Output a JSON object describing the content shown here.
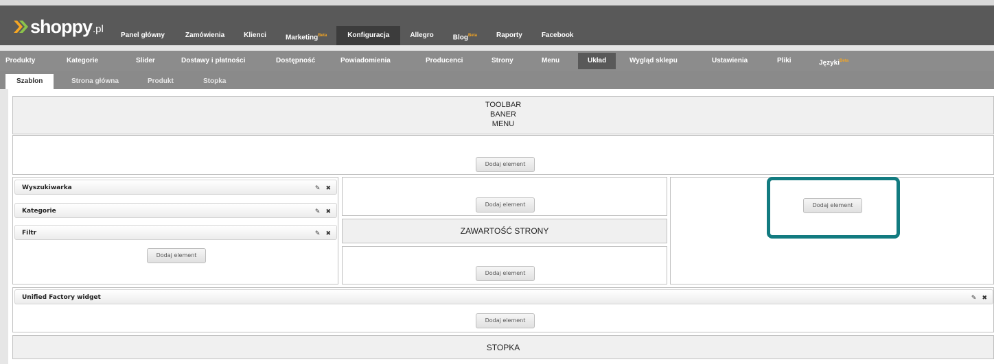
{
  "logo": {
    "brand": "shoppy",
    "tld": ".pl"
  },
  "main_nav": [
    {
      "label": "Panel główny",
      "beta": ""
    },
    {
      "label": "Zamówienia",
      "beta": ""
    },
    {
      "label": "Klienci",
      "beta": ""
    },
    {
      "label": "Marketing",
      "beta": "Beta"
    },
    {
      "label": "Konfiguracja",
      "beta": "",
      "active": true
    },
    {
      "label": "Allegro",
      "beta": ""
    },
    {
      "label": "Blog",
      "beta": "Beta"
    },
    {
      "label": "Raporty",
      "beta": ""
    },
    {
      "label": "Facebook",
      "beta": ""
    }
  ],
  "sub_nav": [
    {
      "label": "Produkty",
      "beta": ""
    },
    {
      "label": "Kategorie",
      "beta": ""
    },
    {
      "label": "Slider",
      "beta": ""
    },
    {
      "label": "Dostawy i płatności",
      "beta": ""
    },
    {
      "label": "Dostępność",
      "beta": ""
    },
    {
      "label": "Powiadomienia",
      "beta": ""
    },
    {
      "label": "Producenci",
      "beta": ""
    },
    {
      "label": "Strony",
      "beta": ""
    },
    {
      "label": "Menu",
      "beta": ""
    },
    {
      "label": "Układ",
      "beta": "",
      "active": true
    },
    {
      "label": "Wygląd sklepu",
      "beta": ""
    },
    {
      "label": "Ustawienia",
      "beta": ""
    },
    {
      "label": "Pliki",
      "beta": ""
    },
    {
      "label": "Języki",
      "beta": "Beta"
    }
  ],
  "tabs": [
    {
      "label": "Szablon",
      "active": true
    },
    {
      "label": "Strona główna"
    },
    {
      "label": "Produkt"
    },
    {
      "label": "Stopka"
    }
  ],
  "layout": {
    "header_lines": [
      "TOOLBAR",
      "BANER",
      "MENU"
    ],
    "add_label": "Dodaj element",
    "left_widgets": [
      "Wyszukiwarka",
      "Kategorie",
      "Filtr"
    ],
    "content_label": "ZAWARTOŚĆ STRONY",
    "wide_widget": "Unified Factory widget",
    "footer_label": "STOPKA"
  },
  "icons": {
    "edit": "pencil-icon",
    "remove": "close-icon"
  },
  "colors": {
    "highlight": "#127b80",
    "beta": "#f5a623",
    "topbar": "#595959",
    "subnav": "#8c8c8c"
  }
}
